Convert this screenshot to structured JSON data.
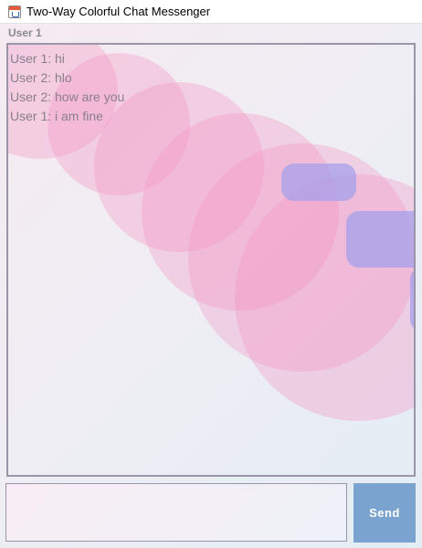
{
  "window": {
    "title": "Two-Way Colorful Chat Messenger",
    "icon": "java-cup-icon"
  },
  "panel": {
    "label": "User 1"
  },
  "messages": [
    "User 1: hi",
    "User 2: hlo",
    "User 2: how are you",
    "User 1: i am fine"
  ],
  "input": {
    "value": "",
    "placeholder": ""
  },
  "send_button": {
    "label": "Send"
  },
  "colors": {
    "circle": "#f496c4",
    "pill": "#a5a0eb",
    "send_button": "#7aa4cf",
    "border": "#9a96a8"
  }
}
